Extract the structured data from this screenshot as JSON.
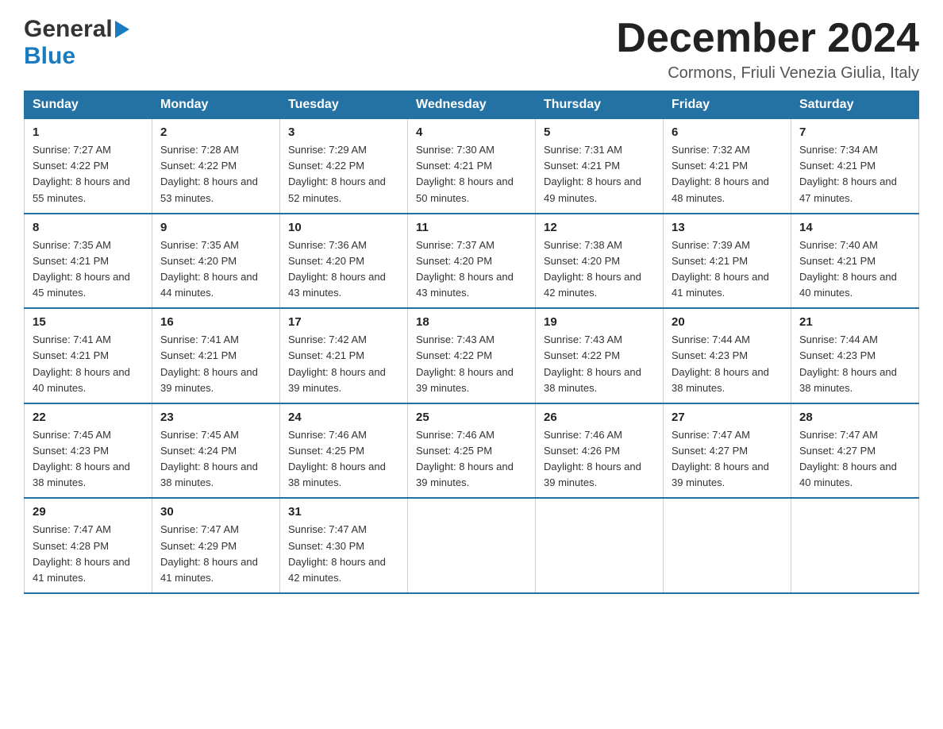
{
  "header": {
    "month": "December 2024",
    "location": "Cormons, Friuli Venezia Giulia, Italy",
    "logo_general": "General",
    "logo_blue": "Blue"
  },
  "days_of_week": [
    "Sunday",
    "Monday",
    "Tuesday",
    "Wednesday",
    "Thursday",
    "Friday",
    "Saturday"
  ],
  "weeks": [
    [
      {
        "day": "1",
        "sunrise": "Sunrise: 7:27 AM",
        "sunset": "Sunset: 4:22 PM",
        "daylight": "Daylight: 8 hours and 55 minutes."
      },
      {
        "day": "2",
        "sunrise": "Sunrise: 7:28 AM",
        "sunset": "Sunset: 4:22 PM",
        "daylight": "Daylight: 8 hours and 53 minutes."
      },
      {
        "day": "3",
        "sunrise": "Sunrise: 7:29 AM",
        "sunset": "Sunset: 4:22 PM",
        "daylight": "Daylight: 8 hours and 52 minutes."
      },
      {
        "day": "4",
        "sunrise": "Sunrise: 7:30 AM",
        "sunset": "Sunset: 4:21 PM",
        "daylight": "Daylight: 8 hours and 50 minutes."
      },
      {
        "day": "5",
        "sunrise": "Sunrise: 7:31 AM",
        "sunset": "Sunset: 4:21 PM",
        "daylight": "Daylight: 8 hours and 49 minutes."
      },
      {
        "day": "6",
        "sunrise": "Sunrise: 7:32 AM",
        "sunset": "Sunset: 4:21 PM",
        "daylight": "Daylight: 8 hours and 48 minutes."
      },
      {
        "day": "7",
        "sunrise": "Sunrise: 7:34 AM",
        "sunset": "Sunset: 4:21 PM",
        "daylight": "Daylight: 8 hours and 47 minutes."
      }
    ],
    [
      {
        "day": "8",
        "sunrise": "Sunrise: 7:35 AM",
        "sunset": "Sunset: 4:21 PM",
        "daylight": "Daylight: 8 hours and 45 minutes."
      },
      {
        "day": "9",
        "sunrise": "Sunrise: 7:35 AM",
        "sunset": "Sunset: 4:20 PM",
        "daylight": "Daylight: 8 hours and 44 minutes."
      },
      {
        "day": "10",
        "sunrise": "Sunrise: 7:36 AM",
        "sunset": "Sunset: 4:20 PM",
        "daylight": "Daylight: 8 hours and 43 minutes."
      },
      {
        "day": "11",
        "sunrise": "Sunrise: 7:37 AM",
        "sunset": "Sunset: 4:20 PM",
        "daylight": "Daylight: 8 hours and 43 minutes."
      },
      {
        "day": "12",
        "sunrise": "Sunrise: 7:38 AM",
        "sunset": "Sunset: 4:20 PM",
        "daylight": "Daylight: 8 hours and 42 minutes."
      },
      {
        "day": "13",
        "sunrise": "Sunrise: 7:39 AM",
        "sunset": "Sunset: 4:21 PM",
        "daylight": "Daylight: 8 hours and 41 minutes."
      },
      {
        "day": "14",
        "sunrise": "Sunrise: 7:40 AM",
        "sunset": "Sunset: 4:21 PM",
        "daylight": "Daylight: 8 hours and 40 minutes."
      }
    ],
    [
      {
        "day": "15",
        "sunrise": "Sunrise: 7:41 AM",
        "sunset": "Sunset: 4:21 PM",
        "daylight": "Daylight: 8 hours and 40 minutes."
      },
      {
        "day": "16",
        "sunrise": "Sunrise: 7:41 AM",
        "sunset": "Sunset: 4:21 PM",
        "daylight": "Daylight: 8 hours and 39 minutes."
      },
      {
        "day": "17",
        "sunrise": "Sunrise: 7:42 AM",
        "sunset": "Sunset: 4:21 PM",
        "daylight": "Daylight: 8 hours and 39 minutes."
      },
      {
        "day": "18",
        "sunrise": "Sunrise: 7:43 AM",
        "sunset": "Sunset: 4:22 PM",
        "daylight": "Daylight: 8 hours and 39 minutes."
      },
      {
        "day": "19",
        "sunrise": "Sunrise: 7:43 AM",
        "sunset": "Sunset: 4:22 PM",
        "daylight": "Daylight: 8 hours and 38 minutes."
      },
      {
        "day": "20",
        "sunrise": "Sunrise: 7:44 AM",
        "sunset": "Sunset: 4:23 PM",
        "daylight": "Daylight: 8 hours and 38 minutes."
      },
      {
        "day": "21",
        "sunrise": "Sunrise: 7:44 AM",
        "sunset": "Sunset: 4:23 PM",
        "daylight": "Daylight: 8 hours and 38 minutes."
      }
    ],
    [
      {
        "day": "22",
        "sunrise": "Sunrise: 7:45 AM",
        "sunset": "Sunset: 4:23 PM",
        "daylight": "Daylight: 8 hours and 38 minutes."
      },
      {
        "day": "23",
        "sunrise": "Sunrise: 7:45 AM",
        "sunset": "Sunset: 4:24 PM",
        "daylight": "Daylight: 8 hours and 38 minutes."
      },
      {
        "day": "24",
        "sunrise": "Sunrise: 7:46 AM",
        "sunset": "Sunset: 4:25 PM",
        "daylight": "Daylight: 8 hours and 38 minutes."
      },
      {
        "day": "25",
        "sunrise": "Sunrise: 7:46 AM",
        "sunset": "Sunset: 4:25 PM",
        "daylight": "Daylight: 8 hours and 39 minutes."
      },
      {
        "day": "26",
        "sunrise": "Sunrise: 7:46 AM",
        "sunset": "Sunset: 4:26 PM",
        "daylight": "Daylight: 8 hours and 39 minutes."
      },
      {
        "day": "27",
        "sunrise": "Sunrise: 7:47 AM",
        "sunset": "Sunset: 4:27 PM",
        "daylight": "Daylight: 8 hours and 39 minutes."
      },
      {
        "day": "28",
        "sunrise": "Sunrise: 7:47 AM",
        "sunset": "Sunset: 4:27 PM",
        "daylight": "Daylight: 8 hours and 40 minutes."
      }
    ],
    [
      {
        "day": "29",
        "sunrise": "Sunrise: 7:47 AM",
        "sunset": "Sunset: 4:28 PM",
        "daylight": "Daylight: 8 hours and 41 minutes."
      },
      {
        "day": "30",
        "sunrise": "Sunrise: 7:47 AM",
        "sunset": "Sunset: 4:29 PM",
        "daylight": "Daylight: 8 hours and 41 minutes."
      },
      {
        "day": "31",
        "sunrise": "Sunrise: 7:47 AM",
        "sunset": "Sunset: 4:30 PM",
        "daylight": "Daylight: 8 hours and 42 minutes."
      },
      null,
      null,
      null,
      null
    ]
  ]
}
